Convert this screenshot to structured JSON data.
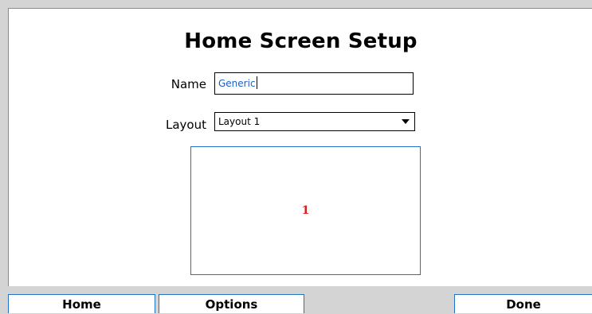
{
  "screen": {
    "title": "Home Screen Setup"
  },
  "form": {
    "name_label": "Name",
    "name_value": "Generic",
    "layout_label": "Layout",
    "layout_value": "Layout 1"
  },
  "preview": {
    "cell_label": "1"
  },
  "bottom_bar": {
    "home_label": "Home",
    "options_label": "Options",
    "done_label": "Done"
  },
  "colors": {
    "accent_border": "#1f73c4",
    "input_text": "#1a5fc8",
    "cell_number": "#d82020",
    "background": "#d4d4d4"
  },
  "icons": {
    "dropdown": "chevron-down-icon"
  }
}
